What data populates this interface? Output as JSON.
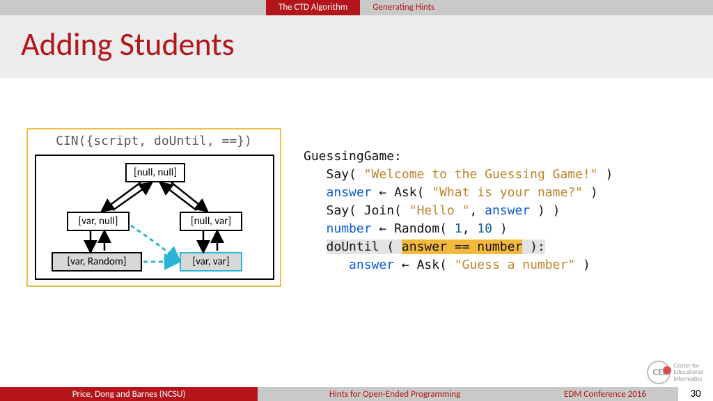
{
  "tabs": {
    "active": "The CTD Algorithm",
    "inactive": "Generating Hints"
  },
  "title": "Adding Students",
  "diagram": {
    "caption": "CIN({script, doUntil, ==})",
    "nodes": {
      "top": "[null, null]",
      "left1": "[var, null]",
      "right1": "[null, var]",
      "left2": "[var, Random]",
      "right2": "[var, var]"
    }
  },
  "code": {
    "header": "GuessingGame:",
    "l1_a": "Say( ",
    "l1_s": "\"Welcome to the Guessing Game!\"",
    "l1_b": " )",
    "l2_a": "answer",
    "l2_arr": " ← ",
    "l2_b": "Ask( ",
    "l2_s": "\"What is your name?\"",
    "l2_c": " )",
    "l3_a": "Say( Join( ",
    "l3_s": "\"Hello \"",
    "l3_b": ", ",
    "l3_c": "answer",
    "l3_d": " ) )",
    "l4_a": "number",
    "l4_arr": " ← ",
    "l4_b": "Random( ",
    "l4_n1": "1",
    "l4_c": ", ",
    "l4_n2": "10",
    "l4_d": " )",
    "l5_a": "doUntil ( ",
    "l5_expr": "answer == number",
    "l5_b": " ):",
    "l6_a": "answer",
    "l6_arr": " ← ",
    "l6_b": "Ask( ",
    "l6_s": "\"Guess a number\"",
    "l6_c": " )"
  },
  "footer": {
    "authors": "Price, Dong and Barnes (NCSU)",
    "mid": "Hints for Open-Ended Programming",
    "right": "EDM Conference 2016",
    "page": "30"
  },
  "logo": {
    "mark": "CEI",
    "line1": "Center for",
    "line2": "Educational",
    "line3": "Informatics"
  }
}
